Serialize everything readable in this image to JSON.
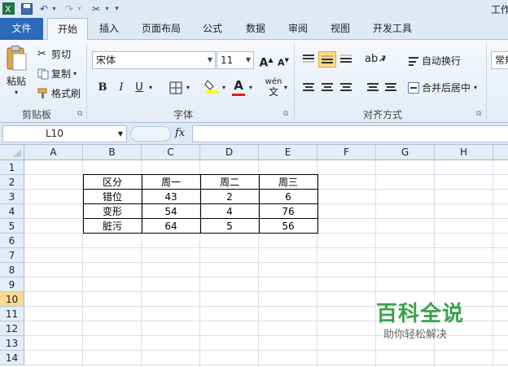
{
  "quick_access": {
    "title": "工作"
  },
  "tabs": [
    "文件",
    "开始",
    "插入",
    "页面布局",
    "公式",
    "数据",
    "审阅",
    "视图",
    "开发工具"
  ],
  "clipboard": {
    "paste": "粘贴",
    "cut": "剪切",
    "copy": "复制",
    "format_painter": "格式刷",
    "group_label": "剪贴板"
  },
  "font": {
    "name": "宋体",
    "size": "11",
    "bold": "B",
    "italic": "I",
    "underline": "U",
    "grow": "A",
    "shrink": "A",
    "color_a": "A",
    "pinyin": "wén",
    "group_label": "字体"
  },
  "alignment": {
    "wrap_text": "自动换行",
    "merge_center": "合并后居中",
    "group_label": "对齐方式"
  },
  "number": {
    "format": "常规"
  },
  "formula_bar": {
    "name_box": "L10",
    "fx": "fx",
    "formula": ""
  },
  "columns": [
    "A",
    "B",
    "C",
    "D",
    "E",
    "F",
    "G",
    "H"
  ],
  "rows": [
    "1",
    "2",
    "3",
    "4",
    "5",
    "6",
    "7",
    "8",
    "9",
    "10",
    "11",
    "12",
    "13",
    "14"
  ],
  "selected_row": "10",
  "table": {
    "header": [
      "区分",
      "周一",
      "周二",
      "周三"
    ],
    "rows": [
      [
        "错位",
        "43",
        "2",
        "6"
      ],
      [
        "变形",
        "54",
        "4",
        "76"
      ],
      [
        "脏污",
        "64",
        "5",
        "56"
      ]
    ]
  },
  "watermark": {
    "title": "百科全说",
    "subtitle": "助你轻松解决"
  },
  "colors": {
    "file_tab": "#2a6ab8",
    "selected_row": "#fbd98e",
    "watermark": "#3aa34a"
  }
}
